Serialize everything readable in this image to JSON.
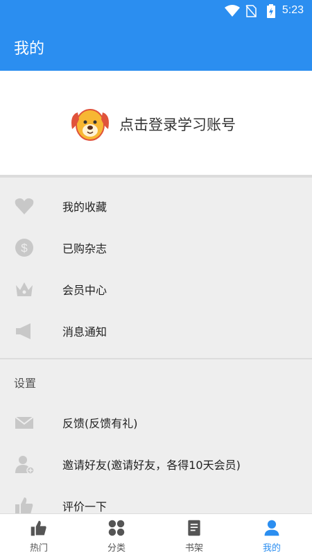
{
  "status_bar": {
    "time": "5:23"
  },
  "header": {
    "title": "我的"
  },
  "login": {
    "prompt": "点击登录学习账号"
  },
  "menu": [
    {
      "label": "我的收藏",
      "icon": "heart-icon"
    },
    {
      "label": "已购杂志",
      "icon": "dollar-icon"
    },
    {
      "label": "会员中心",
      "icon": "crown-icon"
    },
    {
      "label": "消息通知",
      "icon": "megaphone-icon"
    }
  ],
  "settings": {
    "title": "设置",
    "items": [
      {
        "label": "反馈(反馈有礼)",
        "icon": "mail-icon"
      },
      {
        "label": "邀请好友(邀请好友，各得10天会员)",
        "icon": "add-user-icon"
      },
      {
        "label": "评价一下",
        "icon": "thumbs-up-icon"
      }
    ]
  },
  "tabs": [
    {
      "label": "热门",
      "icon": "thumbs-up-icon",
      "active": false
    },
    {
      "label": "分类",
      "icon": "grid-icon",
      "active": false
    },
    {
      "label": "书架",
      "icon": "book-icon",
      "active": false
    },
    {
      "label": "我的",
      "icon": "person-icon",
      "active": true
    }
  ],
  "colors": {
    "accent": "#2b8ef0",
    "icon_gray": "#c8c8c8",
    "background": "#eeeeee"
  }
}
